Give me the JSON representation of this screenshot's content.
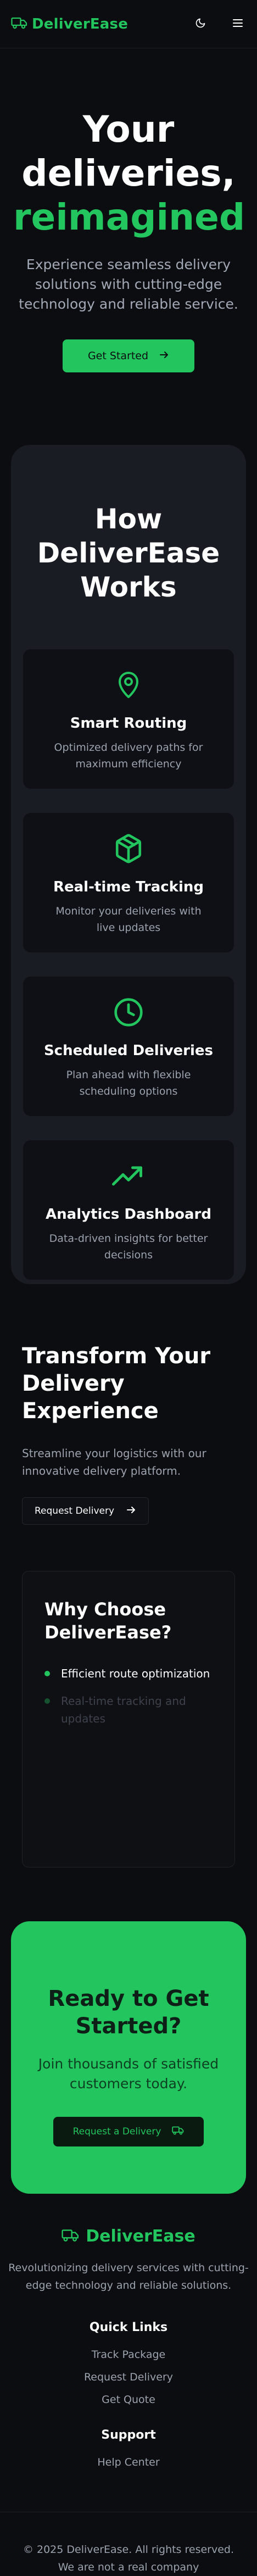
{
  "header": {
    "brand": "DeliverEase",
    "brand_icon": "truck-icon",
    "theme_toggle_icon": "moon-icon",
    "menu_icon": "hamburger-menu-icon"
  },
  "hero": {
    "title_line1": "Your",
    "title_line2": "deliveries,",
    "title_accent": "reimagined",
    "subtitle": "Experience seamless delivery solutions with cutting-edge technology and reliable service.",
    "cta_label": "Get Started"
  },
  "how": {
    "title": "How DeliverEase Works",
    "cards": [
      {
        "icon": "map-pin-icon",
        "title": "Smart Routing",
        "desc": "Optimized delivery paths for maximum efficiency"
      },
      {
        "icon": "package-icon",
        "title": "Real-time Tracking",
        "desc": "Monitor your deliveries with live updates"
      },
      {
        "icon": "clock-icon",
        "title": "Scheduled Deliveries",
        "desc": "Plan ahead with flexible scheduling options"
      },
      {
        "icon": "trending-up-icon",
        "title": "Analytics Dashboard",
        "desc": "Data-driven insights for better decisions"
      }
    ]
  },
  "transform": {
    "title": "Transform Your Delivery Experience",
    "subtitle": "Streamline your logistics with our innovative delivery platform.",
    "button_label": "Request Delivery"
  },
  "why": {
    "title": "Why Choose DeliverEase?",
    "items": [
      "Efficient route optimization",
      "Real-time tracking and updates"
    ]
  },
  "cta": {
    "title": "Ready to Get Started?",
    "subtitle": "Join thousands of satisfied customers today.",
    "button_label": "Request a Delivery"
  },
  "footer": {
    "brand": "DeliverEase",
    "description": "Revolutionizing delivery services with cutting-edge technology and reliable solutions.",
    "quick_links_title": "Quick Links",
    "quick_links": [
      "Track Package",
      "Request Delivery",
      "Get Quote"
    ],
    "support_title": "Support",
    "support_links": [
      "Help Center"
    ],
    "copyright": "© 2025 DeliverEase. All rights reserved.",
    "disclaimer": "We are not a real company"
  },
  "colors": {
    "accent": "#22c55e",
    "background": "#0c0d10",
    "panel": "#1a1c24",
    "muted_text": "#9ca3af"
  }
}
